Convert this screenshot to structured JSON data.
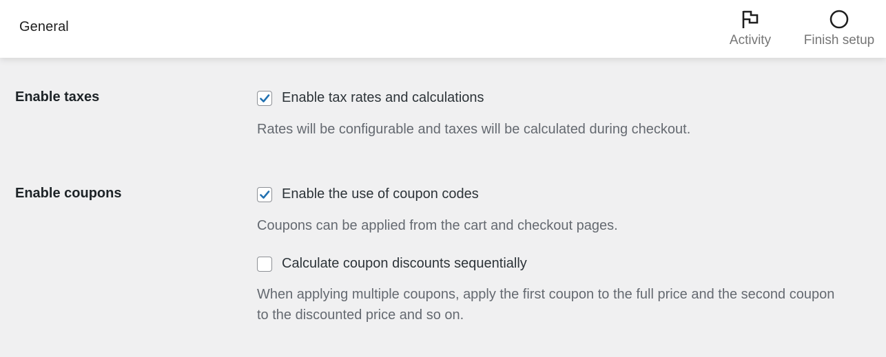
{
  "header": {
    "title": "General",
    "actions": [
      {
        "label": "Activity",
        "icon": "flag-icon"
      },
      {
        "label": "Finish setup",
        "icon": "circle-icon"
      }
    ]
  },
  "settings": {
    "taxes": {
      "label": "Enable taxes",
      "options": [
        {
          "label": "Enable tax rates and calculations",
          "checked": true,
          "description": "Rates will be configurable and taxes will be calculated during checkout."
        }
      ]
    },
    "coupons": {
      "label": "Enable coupons",
      "options": [
        {
          "label": "Enable the use of coupon codes",
          "checked": true,
          "description": "Coupons can be applied from the cart and checkout pages."
        },
        {
          "label": "Calculate coupon discounts sequentially",
          "checked": false,
          "description": "When applying multiple coupons, apply the first coupon to the full price and the second coupon to the discounted price and so on."
        }
      ]
    }
  },
  "colors": {
    "accent": "#2271b1",
    "background": "#f0f0f1",
    "header": "#ffffff",
    "muted_text": "#646970"
  }
}
